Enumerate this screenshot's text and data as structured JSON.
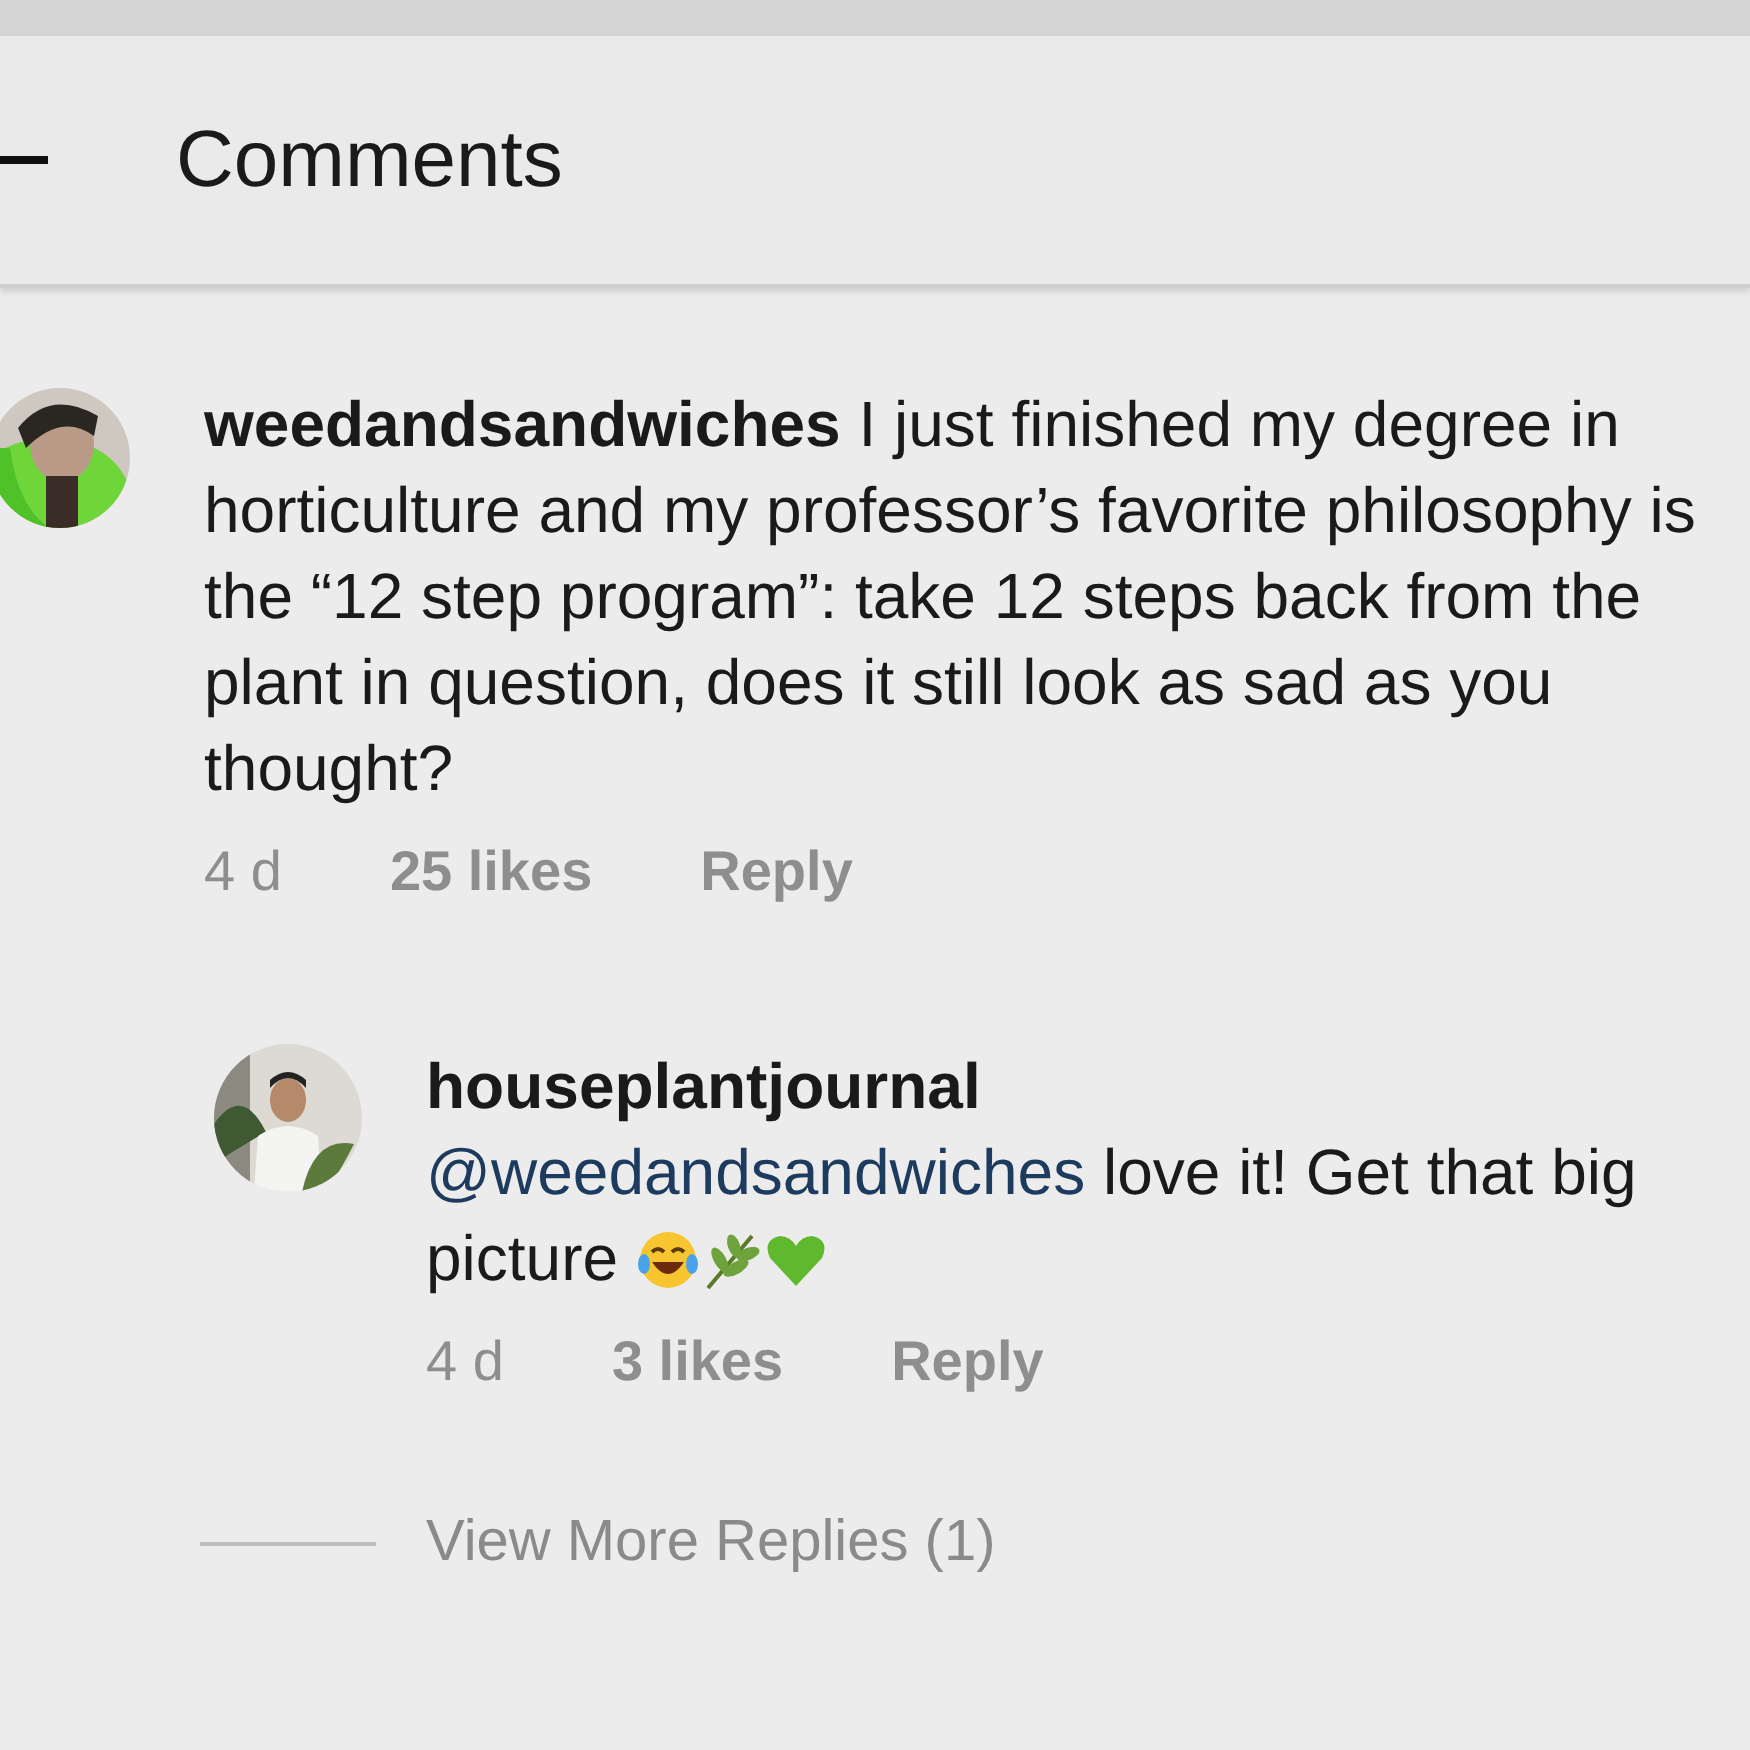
{
  "header": {
    "title": "Comments"
  },
  "comment": {
    "text": "**weedandsandwiches** I just finished my degree in horticulture and my professor’s favorite philosophy is the “12 step program”: take 12 steps back from the plant in question, does it still look as sad as you thought?",
    "time": "4 d",
    "likes": "25 likes",
    "reply_label": "Reply"
  },
  "reply": {
    "username": "houseplantjournal",
    "mention": "@weedandsandwiches",
    "text": " love it! Get that big picture",
    "time": "4 d",
    "likes": "3 likes",
    "reply_label": "Reply"
  },
  "view_more": "View More Replies (1)"
}
